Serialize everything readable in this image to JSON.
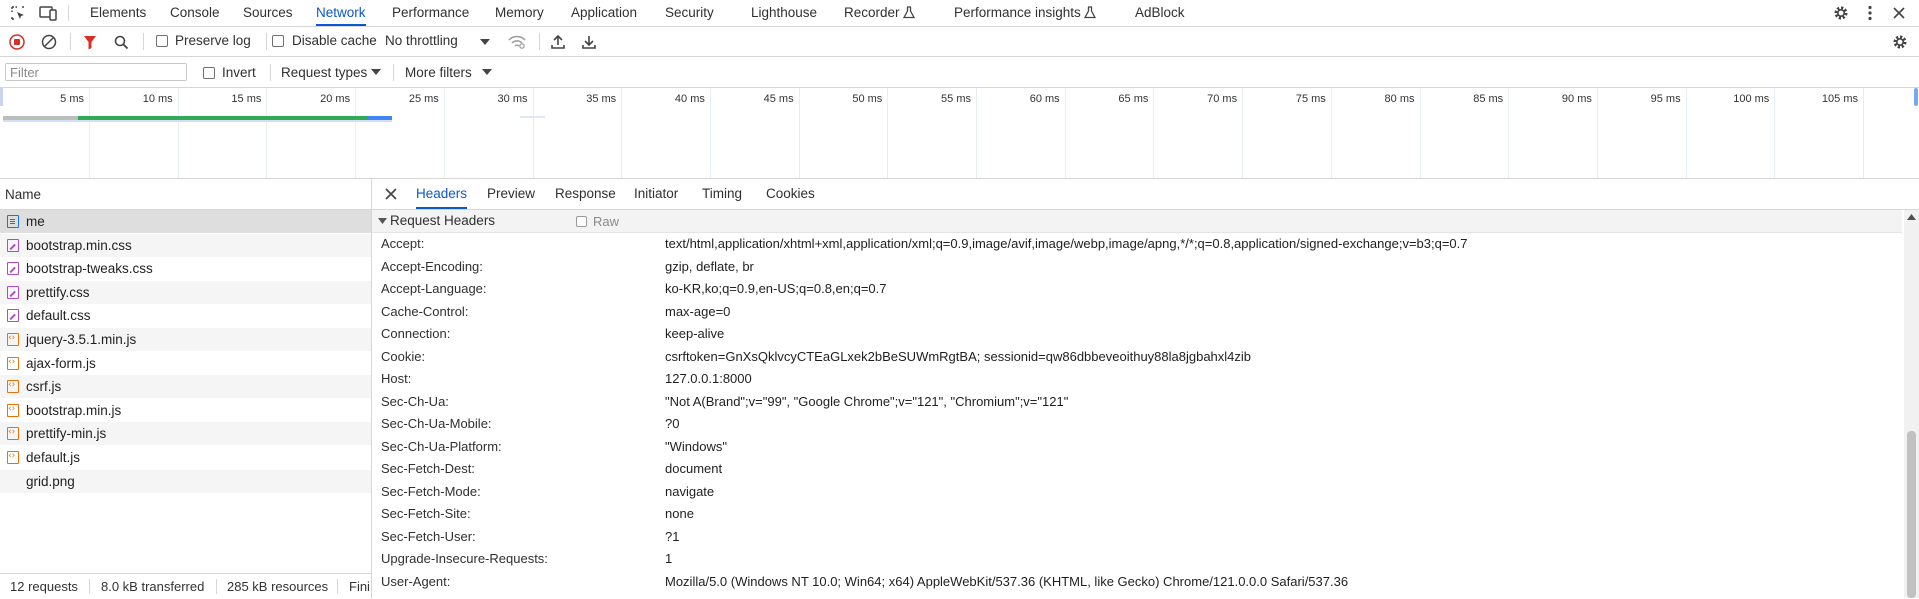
{
  "main_tabs": [
    {
      "label": "Elements"
    },
    {
      "label": "Console"
    },
    {
      "label": "Sources"
    },
    {
      "label": "Network",
      "active": true
    },
    {
      "label": "Performance"
    },
    {
      "label": "Memory"
    },
    {
      "label": "Application"
    },
    {
      "label": "Security"
    },
    {
      "label": "Lighthouse"
    },
    {
      "label": "Recorder"
    },
    {
      "label": "Performance insights"
    },
    {
      "label": "AdBlock"
    }
  ],
  "toolbar": {
    "preserve_log": "Preserve log",
    "disable_cache": "Disable cache",
    "throttling": "No throttling"
  },
  "filter_bar": {
    "placeholder": "Filter",
    "invert": "Invert",
    "request_types": "Request types",
    "more_filters": "More filters"
  },
  "overview": {
    "ticks": [
      "5 ms",
      "10 ms",
      "15 ms",
      "20 ms",
      "25 ms",
      "30 ms",
      "35 ms",
      "40 ms",
      "45 ms",
      "50 ms",
      "55 ms",
      "60 ms",
      "65 ms",
      "70 ms",
      "75 ms",
      "80 ms",
      "85 ms",
      "90 ms",
      "95 ms",
      "100 ms",
      "105 ms"
    ]
  },
  "request_list": {
    "header": "Name",
    "items": [
      {
        "name": "me",
        "type": "doc"
      },
      {
        "name": "bootstrap.min.css",
        "type": "css"
      },
      {
        "name": "bootstrap-tweaks.css",
        "type": "css"
      },
      {
        "name": "prettify.css",
        "type": "css"
      },
      {
        "name": "default.css",
        "type": "css"
      },
      {
        "name": "jquery-3.5.1.min.js",
        "type": "js"
      },
      {
        "name": "ajax-form.js",
        "type": "js"
      },
      {
        "name": "csrf.js",
        "type": "js"
      },
      {
        "name": "bootstrap.min.js",
        "type": "js"
      },
      {
        "name": "prettify-min.js",
        "type": "js"
      },
      {
        "name": "default.js",
        "type": "js"
      },
      {
        "name": "grid.png",
        "type": "img"
      }
    ]
  },
  "status_bar": {
    "requests": "12 requests",
    "transferred": "8.0 kB transferred",
    "resources": "285 kB resources",
    "finish": "Fini"
  },
  "details": {
    "tabs": [
      "Headers",
      "Preview",
      "Response",
      "Initiator",
      "Timing",
      "Cookies"
    ],
    "active_tab": "Headers",
    "section_title": "Request Headers",
    "raw_label": "Raw",
    "headers": [
      {
        "key": "Accept:",
        "value": "text/html,application/xhtml+xml,application/xml;q=0.9,image/avif,image/webp,image/apng,*/*;q=0.8,application/signed-exchange;v=b3;q=0.7"
      },
      {
        "key": "Accept-Encoding:",
        "value": "gzip, deflate, br"
      },
      {
        "key": "Accept-Language:",
        "value": "ko-KR,ko;q=0.9,en-US;q=0.8,en;q=0.7"
      },
      {
        "key": "Cache-Control:",
        "value": "max-age=0"
      },
      {
        "key": "Connection:",
        "value": "keep-alive"
      },
      {
        "key": "Cookie:",
        "value": "csrftoken=GnXsQklvcyCTEaGLxek2bBeSUWmRgtBA; sessionid=qw86dbbeveoithuy88la8jgbahxl4zib"
      },
      {
        "key": "Host:",
        "value": "127.0.0.1:8000"
      },
      {
        "key": "Sec-Ch-Ua:",
        "value": "\"Not A(Brand\";v=\"99\", \"Google Chrome\";v=\"121\", \"Chromium\";v=\"121\""
      },
      {
        "key": "Sec-Ch-Ua-Mobile:",
        "value": "?0"
      },
      {
        "key": "Sec-Ch-Ua-Platform:",
        "value": "\"Windows\""
      },
      {
        "key": "Sec-Fetch-Dest:",
        "value": "document"
      },
      {
        "key": "Sec-Fetch-Mode:",
        "value": "navigate"
      },
      {
        "key": "Sec-Fetch-Site:",
        "value": "none"
      },
      {
        "key": "Sec-Fetch-User:",
        "value": "?1"
      },
      {
        "key": "Upgrade-Insecure-Requests:",
        "value": "1"
      },
      {
        "key": "User-Agent:",
        "value": "Mozilla/5.0 (Windows NT 10.0; Win64; x64) AppleWebKit/537.36 (KHTML, like Gecko) Chrome/121.0.0.0 Safari/537.36"
      }
    ]
  },
  "colors": {
    "accent": "#0b57d0",
    "record": "#d93025",
    "waterfall_green": "#34a853",
    "waterfall_blue": "#4285f4"
  }
}
